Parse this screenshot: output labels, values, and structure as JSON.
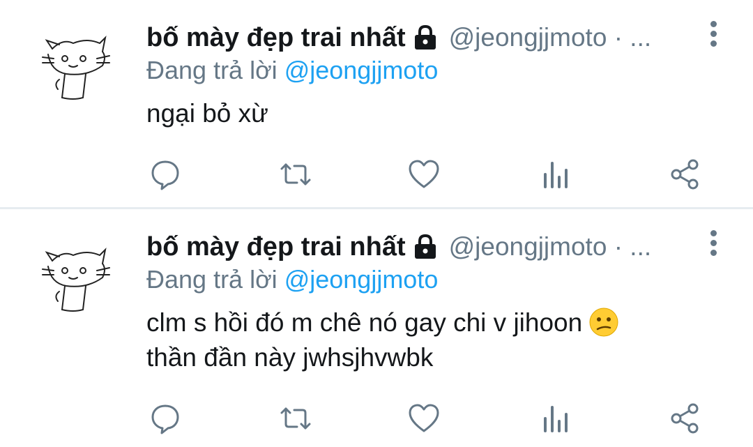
{
  "tweets": [
    {
      "display_name": "bố mày đẹp trai nhất",
      "handle": "@jeongjjmoto · ...",
      "reply_prefix": "Đang trả lời ",
      "reply_to": "@jeongjjmoto",
      "text_line1": "ngại bỏ xừ",
      "text_line2": ""
    },
    {
      "display_name": "bố mày đẹp trai nhất",
      "handle": "@jeongjjmoto · ...",
      "reply_prefix": "Đang trả lời ",
      "reply_to": "@jeongjjmoto",
      "text_line1": "clm s hồi đó m chê nó gay chi v jihoon",
      "text_line2": "thần đần này jwhsjhvwbk",
      "emoji": "confused-face"
    }
  ],
  "icons": {
    "reply": "reply-icon",
    "retweet": "retweet-icon",
    "like": "heart-icon",
    "analytics": "analytics-icon",
    "share": "share-icon",
    "more": "more-vertical-icon",
    "lock": "lock-icon"
  },
  "colors": {
    "link": "#1da1f2",
    "secondary": "#657786",
    "text": "#14171a",
    "divider": "#e6ecf0"
  }
}
